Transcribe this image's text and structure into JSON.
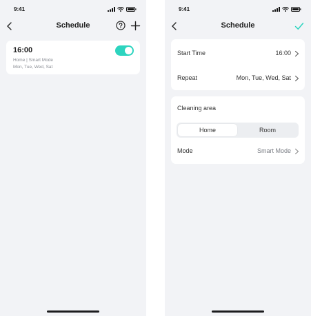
{
  "colors": {
    "accent": "#2dd4bf",
    "background": "#f2f3f6",
    "card": "#ffffff"
  },
  "left": {
    "status": {
      "time": "9:41"
    },
    "nav": {
      "title": "Schedule",
      "back_icon": "chevron-left-icon",
      "help_icon": "question-circle-icon",
      "add_icon": "plus-icon"
    },
    "schedule_item": {
      "time": "16:00",
      "area_mode": "Home | Smart Mode",
      "days": "Mon, Tue, Wed, Sat",
      "enabled": true
    }
  },
  "right": {
    "status": {
      "time": "9:41"
    },
    "nav": {
      "title": "Schedule",
      "back_icon": "chevron-left-icon",
      "confirm_icon": "checkmark-icon"
    },
    "start_time": {
      "label": "Start Time",
      "value": "16:00"
    },
    "repeat": {
      "label": "Repeat",
      "value": "Mon, Tue, Wed, Sat"
    },
    "cleaning_area": {
      "title": "Cleaning area",
      "options": [
        "Home",
        "Room"
      ],
      "selected": "Home"
    },
    "mode": {
      "label": "Mode",
      "value": "Smart Mode"
    }
  }
}
